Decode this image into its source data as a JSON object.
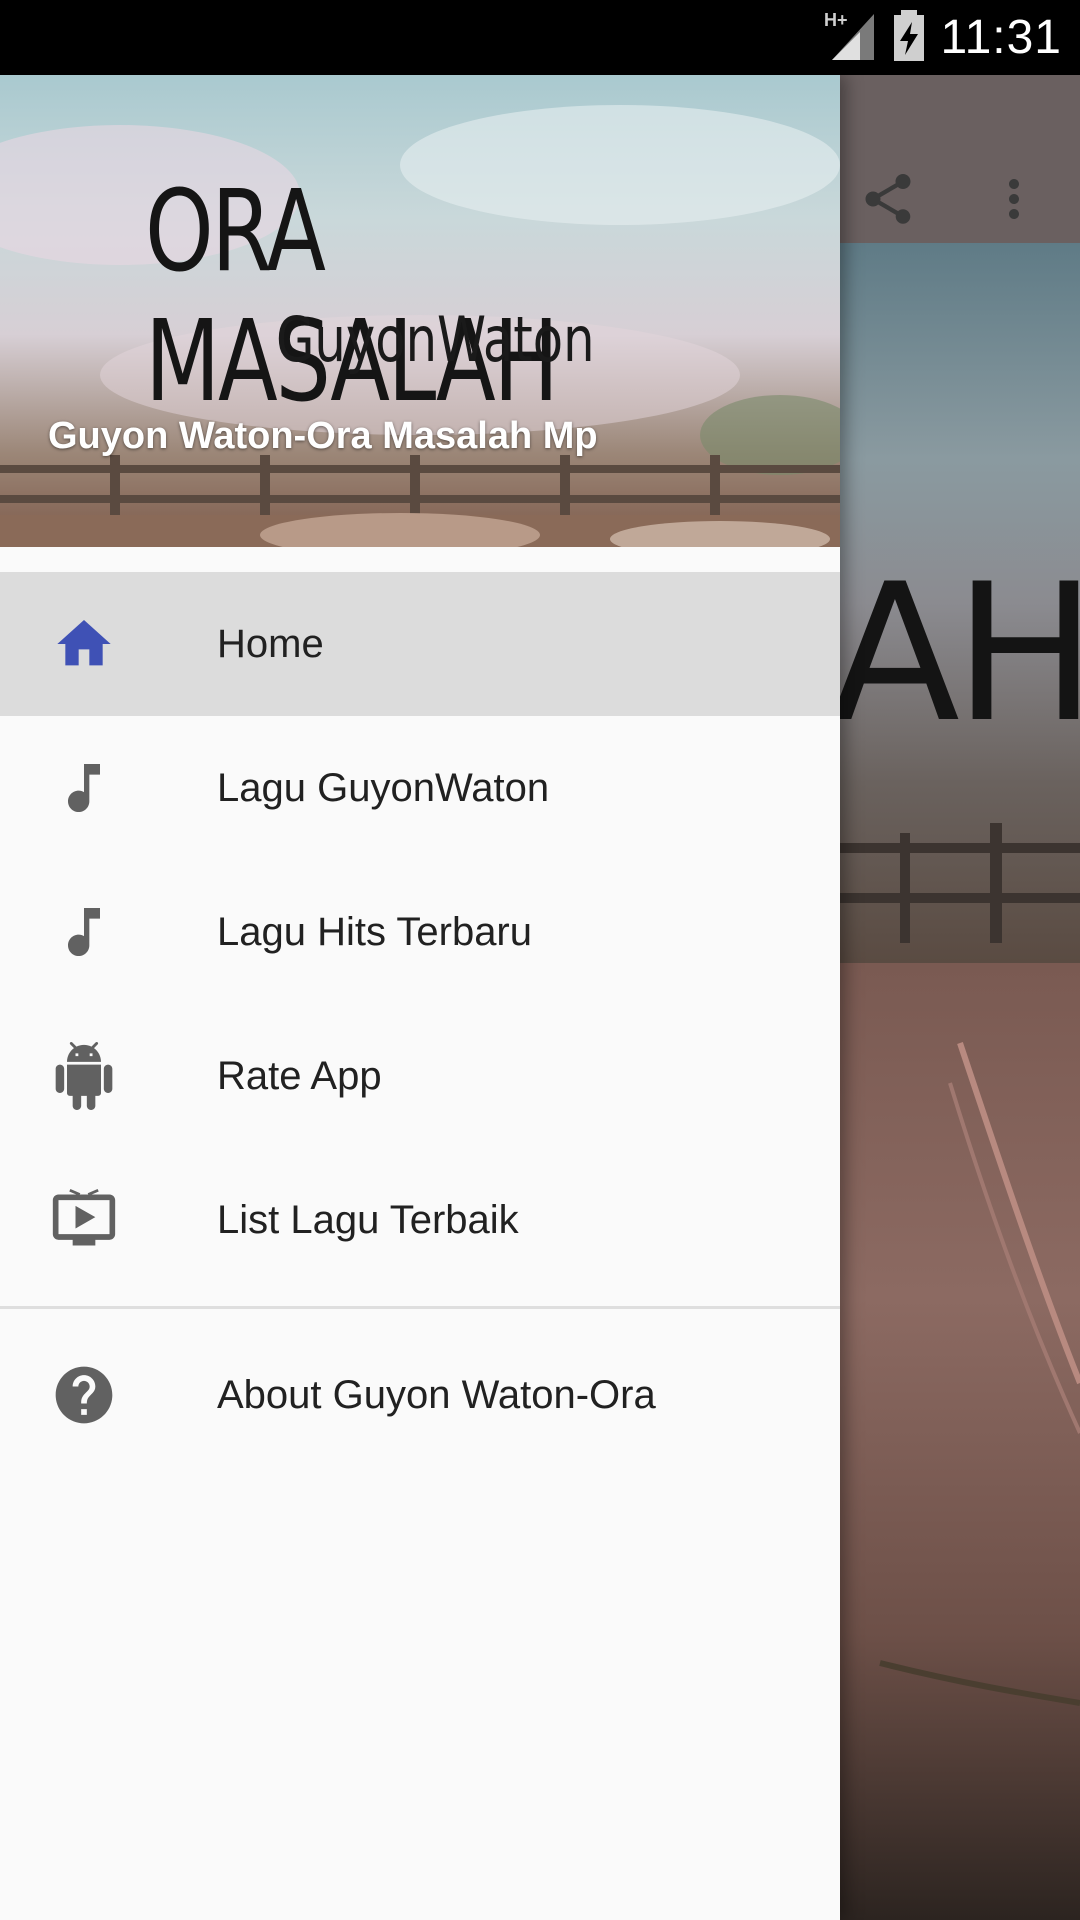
{
  "status_bar": {
    "network": "H+",
    "time": "11:31"
  },
  "background": {
    "banner_text": "AH"
  },
  "drawer": {
    "header": {
      "logo_main": "ORA MASALAH",
      "logo_sub": "GuyonWaton",
      "title": "Guyon Waton-Ora Masalah Mp"
    },
    "items": [
      {
        "label": "Home",
        "icon": "home-icon",
        "selected": true
      },
      {
        "label": "Lagu GuyonWaton",
        "icon": "music-note-icon",
        "selected": false
      },
      {
        "label": "Lagu Hits Terbaru",
        "icon": "music-note-icon",
        "selected": false
      },
      {
        "label": "Rate App",
        "icon": "android-icon",
        "selected": false
      },
      {
        "label": "List Lagu Terbaik",
        "icon": "tv-play-icon",
        "selected": false
      }
    ],
    "secondary_items": [
      {
        "label": "About Guyon Waton-Ora",
        "icon": "help-icon"
      }
    ]
  },
  "colors": {
    "selected_icon": "#3f51b5",
    "icon": "#616161",
    "selected_bg": "#dcdcdc",
    "drawer_bg": "#fafafa"
  }
}
